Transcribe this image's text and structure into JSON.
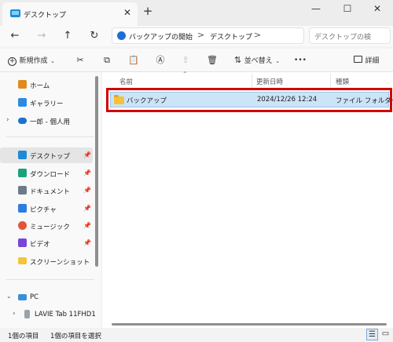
{
  "window": {
    "tab_title": "デスクトップ",
    "tab_close": "✕",
    "new_tab": "+",
    "minimize": "—",
    "maximize": "☐",
    "close": "✕"
  },
  "nav": {
    "back": "←",
    "forward": "→",
    "up": "↑",
    "refresh": "↻"
  },
  "address": {
    "breadcrumb": [
      "バックアップの開始",
      "デスクトップ"
    ],
    "separator": ">",
    "search_placeholder": "デスクトップの検"
  },
  "toolbar": {
    "new_label": "新規作成",
    "sort_label": "並べ替え",
    "more": "•••",
    "details_label": "詳細"
  },
  "sidebar": {
    "items": [
      {
        "label": "ホーム",
        "icon": "home-icon"
      },
      {
        "label": "ギャラリー",
        "icon": "gallery-icon"
      },
      {
        "label": "一郎 - 個人用",
        "icon": "onedrive-icon"
      },
      {
        "label": "デスクトップ",
        "icon": "desktop-icon"
      },
      {
        "label": "ダウンロード",
        "icon": "download-icon"
      },
      {
        "label": "ドキュメント",
        "icon": "document-icon"
      },
      {
        "label": "ピクチャ",
        "icon": "pictures-icon"
      },
      {
        "label": "ミュージック",
        "icon": "music-icon"
      },
      {
        "label": "ビデオ",
        "icon": "video-icon"
      },
      {
        "label": "スクリーンショット",
        "icon": "folder-icon"
      },
      {
        "label": "PC",
        "icon": "pc-icon"
      },
      {
        "label": "LAVIE Tab 11FHD1",
        "icon": "device-icon"
      }
    ]
  },
  "table": {
    "columns": [
      "名前",
      "更新日時",
      "種類"
    ],
    "rows": [
      {
        "name": "バックアップ",
        "modified": "2024/12/26 12:24",
        "type": "ファイル フォルダー"
      }
    ]
  },
  "status": {
    "count": "1個の項目",
    "selected": "1個の項目を選択"
  },
  "colors": {
    "accent": "#0067c0",
    "selection": "#cce4f7",
    "highlight": "#d40000",
    "folder": "#f5c23b"
  }
}
